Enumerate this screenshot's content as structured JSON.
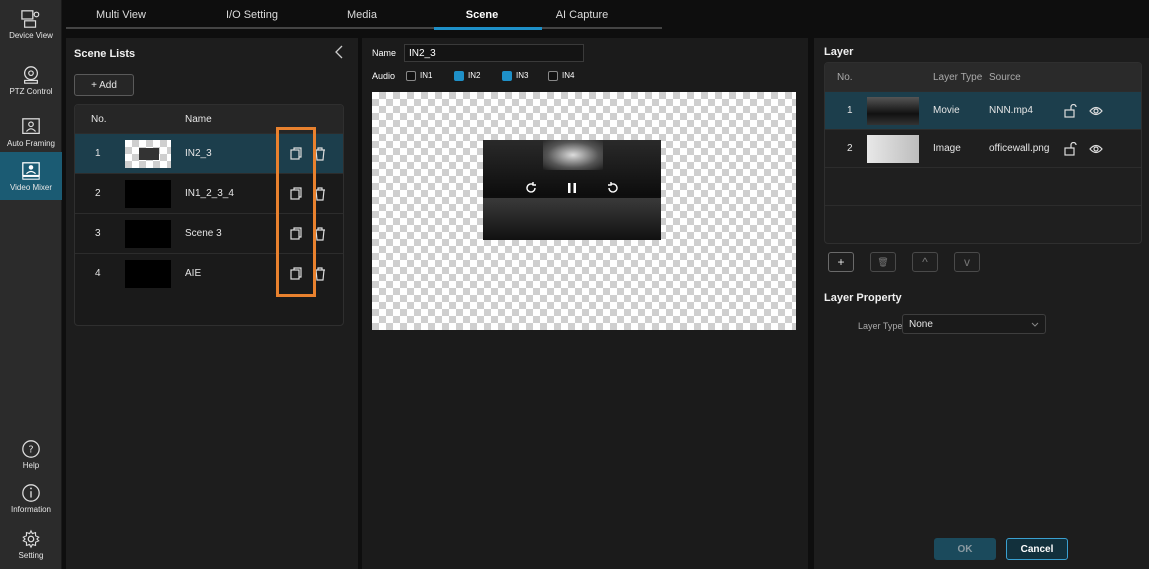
{
  "nav": {
    "items": [
      {
        "label": "Device View",
        "icon": "device-view-icon"
      },
      {
        "label": "PTZ Control",
        "icon": "ptz-camera-icon"
      },
      {
        "label": "Auto Framing",
        "icon": "auto-framing-icon"
      },
      {
        "label": "Video Mixer",
        "icon": "video-mixer-icon",
        "active": true
      }
    ],
    "bottom": [
      {
        "label": "Help",
        "icon": "help-icon"
      },
      {
        "label": "Information",
        "icon": "info-icon"
      },
      {
        "label": "Setting",
        "icon": "gear-icon"
      }
    ]
  },
  "tabs": [
    {
      "label": "Multi View"
    },
    {
      "label": "I/O Setting"
    },
    {
      "label": "Media"
    },
    {
      "label": "Scene",
      "active": true
    },
    {
      "label": "AI Capture"
    }
  ],
  "scenes": {
    "title": "Scene Lists",
    "add_label": "+ Add",
    "col_no": "No.",
    "col_name": "Name",
    "rows": [
      {
        "no": "1",
        "name": "IN2_3"
      },
      {
        "no": "2",
        "name": "IN1_2_3_4"
      },
      {
        "no": "3",
        "name": "Scene 3"
      },
      {
        "no": "4",
        "name": "AIE"
      }
    ]
  },
  "editor": {
    "name_label": "Name",
    "name_value": "IN2_3",
    "audio_label": "Audio",
    "audio": [
      {
        "label": "IN1",
        "checked": false
      },
      {
        "label": "IN2",
        "checked": true
      },
      {
        "label": "IN3",
        "checked": true
      },
      {
        "label": "IN4",
        "checked": false
      }
    ]
  },
  "layer": {
    "title": "Layer",
    "col_no": "No.",
    "col_type": "Layer Type",
    "col_source": "Source",
    "rows": [
      {
        "no": "1",
        "type": "Movie",
        "source": "NNN.mp4"
      },
      {
        "no": "2",
        "type": "Image",
        "source": "officewall.png"
      }
    ],
    "controls": [
      "+",
      "🗑",
      "^",
      "v"
    ],
    "property_title": "Layer Property",
    "type_label": "Layer Type",
    "type_value": "None"
  },
  "footer": {
    "ok_label": "OK",
    "cancel_label": "Cancel"
  },
  "colors": {
    "accent": "#1e90c8",
    "active_nav": "#1b5b73",
    "selected_row": "#1c3e4c",
    "highlight": "#e8812e"
  }
}
